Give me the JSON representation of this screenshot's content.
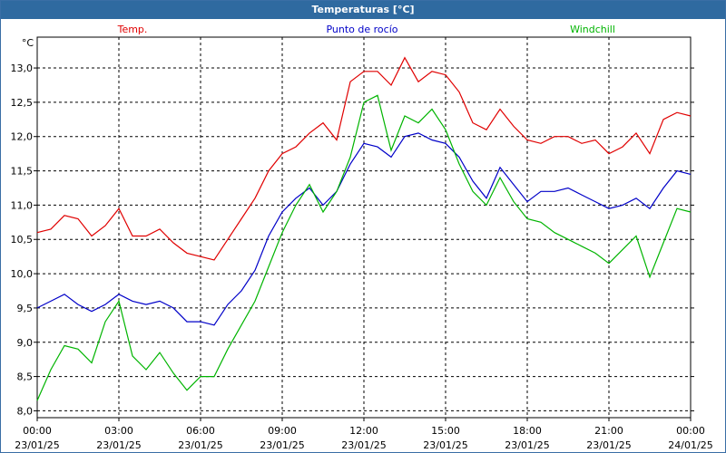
{
  "window": {
    "title": "Temperaturas [°C]"
  },
  "chart_data": {
    "type": "line",
    "title": "Temperaturas [°C]",
    "ylabel": "°C",
    "ylim": [
      7.9,
      13.45
    ],
    "yticks": [
      "8,0",
      "8,5",
      "9,0",
      "9,5",
      "10,0",
      "10,5",
      "11,0",
      "11,5",
      "12,0",
      "12,5",
      "13,0"
    ],
    "xtick_times": [
      "00:00",
      "03:00",
      "06:00",
      "09:00",
      "12:00",
      "15:00",
      "18:00",
      "21:00",
      "00:00"
    ],
    "xtick_dates": [
      "23/01/25",
      "23/01/25",
      "23/01/25",
      "23/01/25",
      "23/01/25",
      "23/01/25",
      "23/01/25",
      "23/01/25",
      "24/01/25"
    ],
    "grid": true,
    "legend_position": "top",
    "x_hours": [
      0,
      0.5,
      1,
      1.5,
      2,
      2.5,
      3,
      3.5,
      4,
      4.5,
      5,
      5.5,
      6,
      6.5,
      7,
      7.5,
      8,
      8.5,
      9,
      9.5,
      10,
      10.5,
      11,
      11.5,
      12,
      12.5,
      13,
      13.5,
      14,
      14.5,
      15,
      15.5,
      16,
      16.5,
      17,
      17.5,
      18,
      18.5,
      19,
      19.5,
      20,
      20.5,
      21,
      21.5,
      22,
      22.5,
      23,
      23.5,
      24
    ],
    "series": [
      {
        "name": "Temp.",
        "color": "#e00000",
        "values": [
          10.6,
          10.65,
          10.85,
          10.8,
          10.55,
          10.7,
          10.95,
          10.55,
          10.55,
          10.65,
          10.45,
          10.3,
          10.25,
          10.2,
          10.5,
          10.8,
          11.1,
          11.5,
          11.75,
          11.85,
          12.05,
          12.2,
          11.95,
          12.8,
          12.95,
          12.95,
          12.75,
          13.15,
          12.8,
          12.95,
          12.9,
          12.65,
          12.2,
          12.1,
          12.4,
          12.15,
          11.95,
          11.9,
          12.0,
          12.0,
          11.9,
          11.95,
          11.75,
          11.85,
          12.05,
          11.75,
          12.25,
          12.35,
          12.3
        ]
      },
      {
        "name": "Punto de rocío",
        "color": "#0000c8",
        "values": [
          9.5,
          9.6,
          9.7,
          9.55,
          9.45,
          9.55,
          9.7,
          9.6,
          9.55,
          9.6,
          9.5,
          9.3,
          9.3,
          9.25,
          9.55,
          9.75,
          10.05,
          10.55,
          10.9,
          11.1,
          11.25,
          11.0,
          11.2,
          11.6,
          11.9,
          11.85,
          11.7,
          12.0,
          12.05,
          11.95,
          11.9,
          11.7,
          11.35,
          11.1,
          11.55,
          11.3,
          11.05,
          11.2,
          11.2,
          11.25,
          11.15,
          11.05,
          10.95,
          11.0,
          11.1,
          10.95,
          11.25,
          11.5,
          11.45
        ]
      },
      {
        "name": "Windchill",
        "color": "#00b400",
        "values": [
          8.15,
          8.6,
          8.95,
          8.9,
          8.7,
          9.3,
          9.6,
          8.8,
          8.6,
          8.85,
          8.55,
          8.3,
          8.5,
          8.5,
          8.9,
          9.25,
          9.6,
          10.1,
          10.6,
          11.0,
          11.3,
          10.9,
          11.2,
          11.7,
          12.5,
          12.6,
          11.8,
          12.3,
          12.2,
          12.4,
          12.1,
          11.6,
          11.2,
          11.0,
          11.4,
          11.05,
          10.8,
          10.75,
          10.6,
          10.5,
          10.4,
          10.3,
          10.15,
          10.35,
          10.55,
          9.95,
          10.45,
          10.95,
          10.9
        ]
      }
    ]
  }
}
